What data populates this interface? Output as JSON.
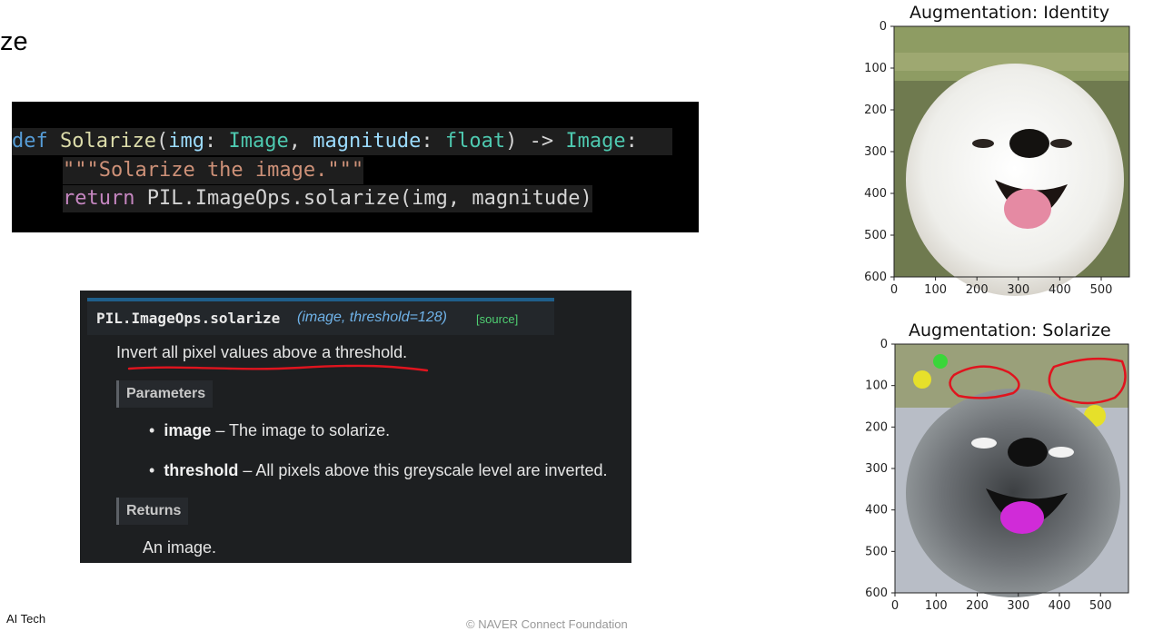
{
  "slide": {
    "title_fragment": "ze",
    "footer_left": "AI Tech",
    "footer_mid": "© NAVER Connect Foundation"
  },
  "code": {
    "line1": {
      "kw_def": "def",
      "fn_name": "Solarize",
      "lparen": "(",
      "arg_img": "img",
      "colon1": ": ",
      "type_image": "Image",
      "comma": ", ",
      "arg_mag": "magnitude",
      "colon2": ": ",
      "type_float": "float",
      "rparen_arrow": ") -> ",
      "ret_type": "Image",
      "end_colon": ":"
    },
    "line2": {
      "docstring": "\"\"\"Solarize the image.\"\"\""
    },
    "line3": {
      "kw_return": "return",
      "expr": " PIL.ImageOps.solarize(img, magnitude)"
    }
  },
  "docs": {
    "signature_func": "PIL.ImageOps.solarize",
    "signature_args": "(image, threshold=128)",
    "source_link": "[source]",
    "description": "Invert all pixel values above a threshold.",
    "params_header": "Parameters",
    "params": [
      {
        "name": "image",
        "desc": " – The image to solarize."
      },
      {
        "name": "threshold",
        "desc": " – All pixels above this greyscale level are inverted."
      }
    ],
    "returns_header": "Returns",
    "returns_text": "An image."
  },
  "colors": {
    "annotation_red": "#e0141e",
    "source_green": "#4fcf72",
    "arg_blue": "#6fb2e8"
  },
  "plots": [
    {
      "title": "Augmentation: Identity",
      "x_ticks": [
        "0",
        "100",
        "200",
        "300",
        "400",
        "500"
      ],
      "y_ticks": [
        "0",
        "100",
        "200",
        "300",
        "400",
        "500",
        "600"
      ],
      "image": "white-pomeranian-dog-photo"
    },
    {
      "title": "Augmentation: Solarize",
      "x_ticks": [
        "0",
        "100",
        "200",
        "300",
        "400",
        "500"
      ],
      "y_ticks": [
        "0",
        "100",
        "200",
        "300",
        "400",
        "500",
        "600"
      ],
      "image": "solarized-pomeranian-dog-photo"
    }
  ]
}
